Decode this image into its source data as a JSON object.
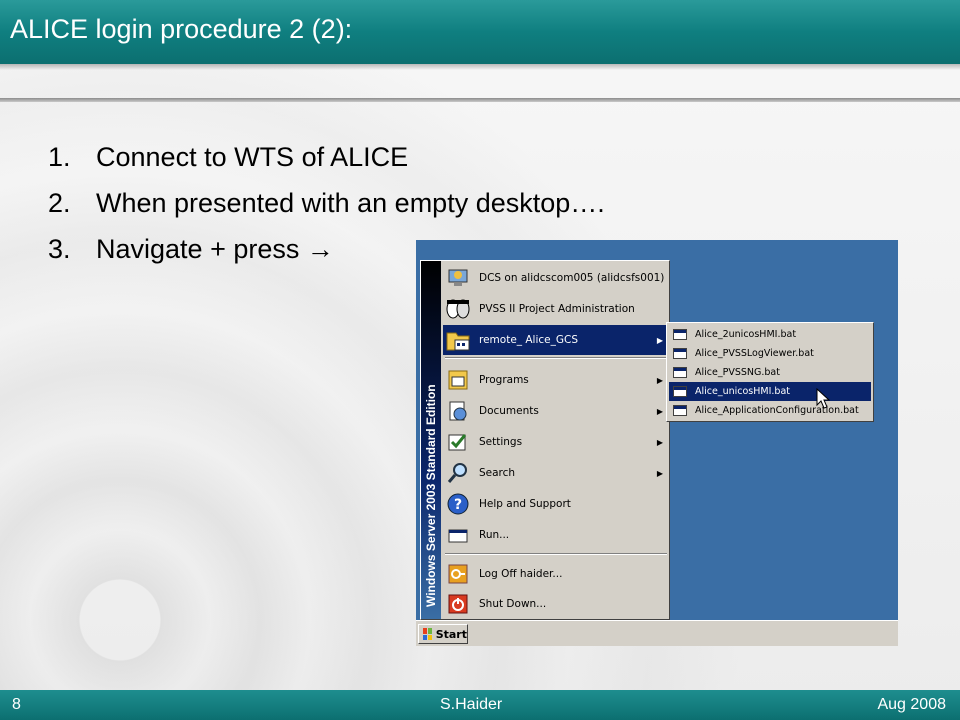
{
  "slide": {
    "title": "ALICE login procedure 2 (2):",
    "steps": [
      {
        "num": "1.",
        "text": "Connect to WTS of ALICE"
      },
      {
        "num": "2.",
        "text": "When presented with an empty desktop…."
      },
      {
        "num": "3.",
        "text": "Navigate + press →"
      }
    ],
    "footer": {
      "page": "8",
      "author": "S.Haider",
      "date": "Aug 2008"
    }
  },
  "screenshot": {
    "sidebar_text": "Windows Server 2003 Standard Edition",
    "menu_items": [
      {
        "label": "DCS on alidcscom005 (alidcsfs001)",
        "icon": "computer-icon"
      },
      {
        "label": "PVSS II Project Administration",
        "icon": "pvss-faces-icon"
      },
      {
        "label": "remote_ Alice_GCS",
        "icon": "program-folder-icon",
        "selected": true,
        "submenu": true
      },
      {
        "label": "Programs",
        "icon": "programs-icon",
        "submenu": true
      },
      {
        "label": "Documents",
        "icon": "documents-icon",
        "submenu": true
      },
      {
        "label": "Settings",
        "icon": "settings-icon",
        "submenu": true
      },
      {
        "label": "Search",
        "icon": "search-icon",
        "submenu": true
      },
      {
        "label": "Help and Support",
        "icon": "help-icon"
      },
      {
        "label": "Run...",
        "icon": "run-icon"
      },
      {
        "label": "Log Off haider...",
        "icon": "logoff-icon"
      },
      {
        "label": "Shut Down...",
        "icon": "shutdown-icon"
      }
    ],
    "submenu_items": [
      {
        "label": "Alice_2unicosHMI.bat"
      },
      {
        "label": "Alice_PVSSLogViewer.bat"
      },
      {
        "label": "Alice_PVSSNG.bat"
      },
      {
        "label": "Alice_unicosHMI.bat",
        "selected": true
      },
      {
        "label": "Alice_ApplicationConfiguration.bat"
      }
    ],
    "start_label": "Start",
    "colors": {
      "selection": "#0a246a",
      "desktop": "#3a6ea5",
      "menu_face": "#d4d0c8",
      "theme": "#0f7f80"
    }
  }
}
